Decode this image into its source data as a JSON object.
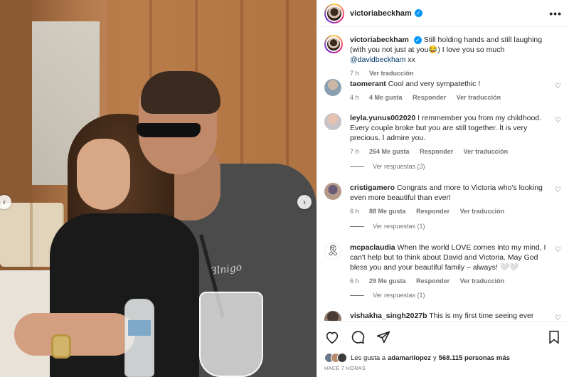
{
  "post": {
    "username": "victoriabeckham",
    "verified": true,
    "more_label": "•••"
  },
  "photo": {
    "shirt_print": "Blnigo"
  },
  "caption": {
    "username": "victoriabeckham",
    "text": "Still holding hands and still laughing (with you not just at you😂) I love you so much",
    "mention": "@davidbeckham",
    "suffix": "xx",
    "time": "7 h",
    "translate": "Ver traducción"
  },
  "comments": [
    {
      "username": "taomerant",
      "text": "Cool and very sympatethic !",
      "time": "4 h",
      "likes": "4 Me gusta",
      "reply": "Responder",
      "translate": "Ver traducción",
      "replies": ""
    },
    {
      "username": "leyla.yunus002020",
      "text": "I remmember you from my childhood. Every couple broke but you are still together. İt is very precious. İ admire you.",
      "time": "7 h",
      "likes": "264 Me gusta",
      "reply": "Responder",
      "translate": "Ver traducción",
      "replies": "Ver respuestas (3)"
    },
    {
      "username": "cristigamero",
      "text": "Congrats and more to Victoria who's looking even more beautiful than ever!",
      "time": "6 h",
      "likes": "88 Me gusta",
      "reply": "Responder",
      "translate": "Ver traducción",
      "replies": "Ver respuestas (1)"
    },
    {
      "username": "mcpaclaudia",
      "text": "When the world LOVE comes into my mind, I can't help but to think about David and Victoria. May God bless you and your beautiful family – always! 🤍🤍",
      "time": "6 h",
      "likes": "29 Me gusta",
      "reply": "Responder",
      "translate": "Ver traducción",
      "replies": "Ver respuestas (1)"
    },
    {
      "username": "vishakha_singh2027b",
      "text": "This is my first time seeing ever lasting"
    }
  ],
  "likes": {
    "prefix": "Les gusta a",
    "user": "adamarilopez",
    "middle": "y",
    "count": "568.115 personas más"
  },
  "time_ago": "HACE 7 HORAS",
  "icons": [
    "heart-icon",
    "comment-icon",
    "share-icon",
    "bookmark-icon",
    "more-icon",
    "chevron-left-icon",
    "chevron-right-icon",
    "verified-badge-icon"
  ]
}
